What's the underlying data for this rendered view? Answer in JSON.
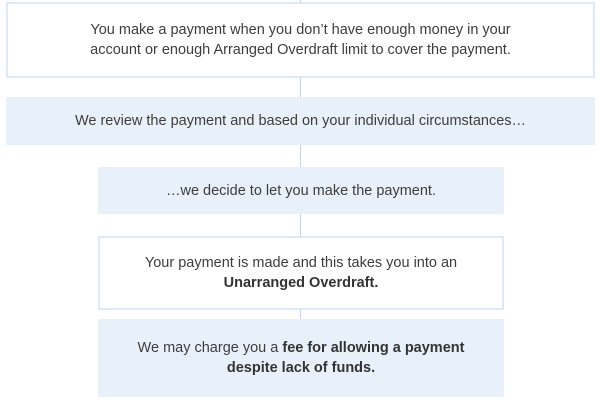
{
  "steps": [
    {
      "id": "step-1",
      "style": "outlined",
      "lines": [
        {
          "text": "You make a payment when you don’t have enough money in your"
        },
        {
          "text": "account or enough Arranged Overdraft limit to cover the payment."
        }
      ]
    },
    {
      "id": "step-2",
      "style": "filled",
      "lines": [
        {
          "text": "We review the payment and based on your individual circumstances…"
        }
      ]
    },
    {
      "id": "step-3",
      "style": "filled",
      "lines": [
        {
          "text": "…we decide to let you make the payment."
        }
      ]
    },
    {
      "id": "step-4",
      "style": "outlined",
      "lines": [
        {
          "text": "Your payment is made and this takes you into an"
        },
        {
          "text": "Unarranged Overdraft.",
          "bold": true
        }
      ]
    },
    {
      "id": "step-5",
      "style": "filled",
      "lines": [
        {
          "pre": "We may charge you a ",
          "text": "fee for allowing a payment",
          "bold": true
        },
        {
          "text": "despite lack of funds.",
          "bold": true
        }
      ]
    }
  ],
  "colors": {
    "outline_border": "#dde9f5",
    "filled_background": "#e8f1fa",
    "connector": "#c9d3de",
    "text": "#3d3d3d"
  }
}
